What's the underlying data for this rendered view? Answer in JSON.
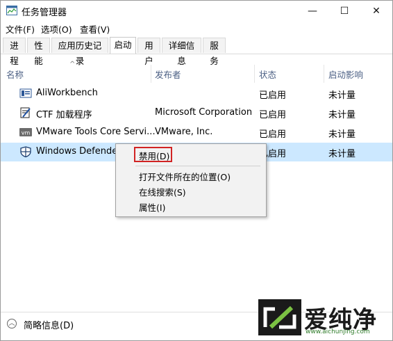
{
  "window": {
    "title": "任务管理器",
    "minimize_glyph": "—",
    "maximize_glyph": "☐",
    "close_glyph": "✕"
  },
  "menu": [
    {
      "label": "文件(F)"
    },
    {
      "label": "选项(O)"
    },
    {
      "label": "查看(V)"
    }
  ],
  "tabs": [
    {
      "label": "进程"
    },
    {
      "label": "性能"
    },
    {
      "label": "应用历史记录"
    },
    {
      "label": "启动",
      "active": true
    },
    {
      "label": "用户"
    },
    {
      "label": "详细信息"
    },
    {
      "label": "服务"
    }
  ],
  "columns": {
    "name": "名称",
    "publisher": "发布者",
    "status": "状态",
    "impact": "启动影响",
    "sort_indicator": "^"
  },
  "rows": [
    {
      "name": "AliWorkbench",
      "publisher": "",
      "status": "已启用",
      "impact": "未计量",
      "icon": "aliworkbench-icon"
    },
    {
      "name": "CTF 加载程序",
      "publisher": "Microsoft Corporation",
      "status": "已启用",
      "impact": "未计量",
      "icon": "ctf-loader-icon"
    },
    {
      "name": "VMware Tools Core Servi...",
      "publisher": "VMware, Inc.",
      "status": "已启用",
      "impact": "未计量",
      "icon": "vmware-icon"
    },
    {
      "name": "Windows Defender",
      "publisher": "",
      "status": "已启用",
      "impact": "未计量",
      "icon": "windows-defender-icon",
      "selected": true
    }
  ],
  "context_menu": {
    "items": [
      {
        "label": "禁用(D)"
      },
      {
        "label": "打开文件所在的位置(O)"
      },
      {
        "label": "在线搜索(S)"
      },
      {
        "label": "属性(I)"
      }
    ]
  },
  "footer": {
    "label": "简略信息(D)"
  },
  "watermark": {
    "text": "爱纯净",
    "url": "www.aichunjing.com"
  },
  "colors": {
    "selection": "#cce8ff",
    "column_header": "#4d6185",
    "highlight_border": "#d12323"
  }
}
